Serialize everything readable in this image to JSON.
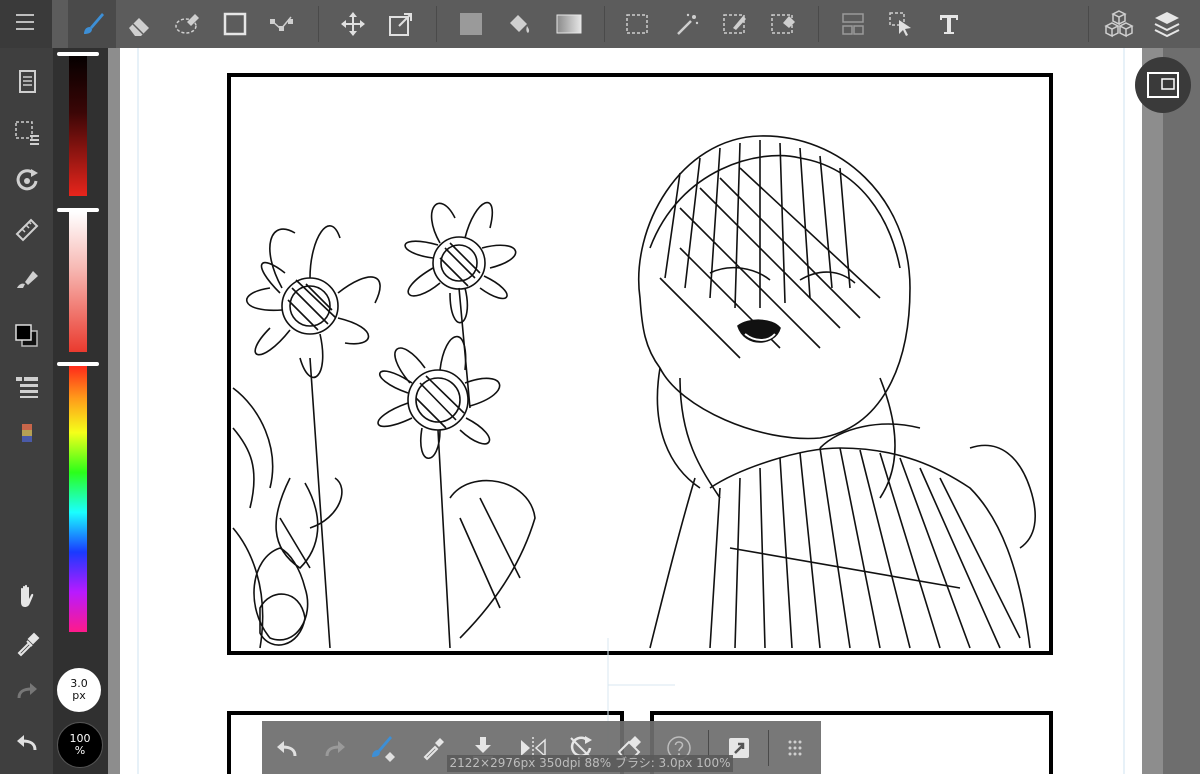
{
  "toolbar": {
    "items": [
      "menu",
      "brush",
      "eraser",
      "lasso-eraser",
      "rectangle",
      "snap",
      "move",
      "transform",
      "fill-color",
      "bucket",
      "gradient",
      "select-rect",
      "magic-wand",
      "select-pen",
      "select-eraser",
      "frame-divide",
      "select-layer",
      "text",
      "material",
      "layers"
    ]
  },
  "colors": {
    "accent": "#3d8fd6",
    "toolbar_bg": "#5c5c5c",
    "panel_bg": "#3f3f3f",
    "canvas_bg": "#8d8d8d"
  },
  "brush": {
    "size_value": "3.0",
    "size_unit": "px",
    "opacity_value": "100",
    "opacity_unit": "%"
  },
  "statusbar": {
    "text": "2122×2976px 350dpi 88% ブラシ: 3.0px 100%"
  },
  "bottom_tools": [
    "undo",
    "redo",
    "brush-settings",
    "eyedropper",
    "save",
    "flip",
    "rotate",
    "transparent-eraser",
    "help",
    "share",
    "more"
  ]
}
